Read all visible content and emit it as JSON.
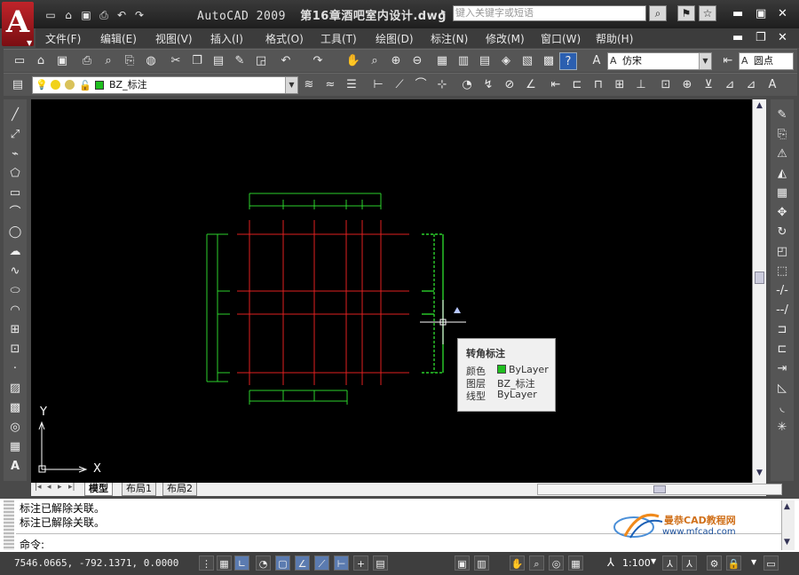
{
  "titlebar": {
    "app_name": "AutoCAD 2009",
    "document": "第16章酒吧室内设计.dwg",
    "search_placeholder": "键入关键字或短语"
  },
  "menu": [
    {
      "label": "文件(F)"
    },
    {
      "label": "编辑(E)"
    },
    {
      "label": "视图(V)"
    },
    {
      "label": "插入(I)"
    },
    {
      "label": "格式(O)"
    },
    {
      "label": "工具(T)"
    },
    {
      "label": "绘图(D)"
    },
    {
      "label": "标注(N)"
    },
    {
      "label": "修改(M)"
    },
    {
      "label": "窗口(W)"
    },
    {
      "label": "帮助(H)"
    }
  ],
  "toolbar": {
    "text_style": "仿宋",
    "dim_style": "圆点",
    "layer": "BZ_标注"
  },
  "layout_tabs": [
    {
      "label": "模型",
      "active": true
    },
    {
      "label": "布局1",
      "active": false
    },
    {
      "label": "布局2",
      "active": false
    }
  ],
  "ucs": {
    "x_label": "X",
    "y_label": "Y"
  },
  "tooltip": {
    "title": "转角标注",
    "rows": [
      {
        "key": "颜色",
        "value": "ByLayer",
        "swatch": "#1fbf1f"
      },
      {
        "key": "图层",
        "value": "BZ_标注"
      },
      {
        "key": "线型",
        "value": "ByLayer"
      }
    ]
  },
  "command": {
    "history": [
      "标注已解除关联。",
      "标注已解除关联。"
    ],
    "prompt": "命令:"
  },
  "watermark": {
    "site_name": "曼恭CAD教程网",
    "url": "www.mfcad.com"
  },
  "status": {
    "coordinates": "7546.0665, -792.1371, 0.0000",
    "annotation_scale": "1:100"
  },
  "colors": {
    "canvas_bg": "#000000",
    "dimension": "#2bd12b",
    "axis_lines": "#e02020",
    "ucs": "#ffffff"
  }
}
